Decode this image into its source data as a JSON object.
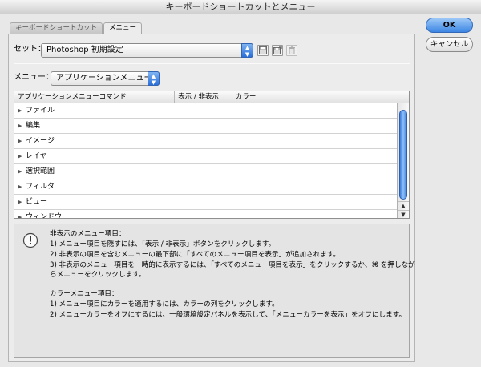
{
  "window": {
    "title": "キーボードショートカットとメニュー"
  },
  "tabs": [
    "キーボードショートカット",
    "メニュー"
  ],
  "set": {
    "label": "セット：",
    "value": "Photoshop 初期設定"
  },
  "menu": {
    "label": "メニュー：",
    "value": "アプリケーションメニュー"
  },
  "icons": {
    "save": "save-icon",
    "save_as": "save-as-icon",
    "delete": "trash-icon"
  },
  "table": {
    "columns": [
      "アプリケーションメニューコマンド",
      "表示 / 非表示",
      "カラー"
    ],
    "rows": [
      "ファイル",
      "編集",
      "イメージ",
      "レイヤー",
      "選択範囲",
      "フィルタ",
      "ビュー",
      "ウィンドウ"
    ]
  },
  "info": {
    "hidden_title": "非表示のメニュー項目：",
    "hidden_1": "1) メニュー項目を隠すには、「表示 / 非表示」ボタンをクリックします。",
    "hidden_2": "2) 非表示の項目を含むメニューの最下部に「すべてのメニュー項目を表示」が追加されます。",
    "hidden_3a": "3) 非表示のメニュー項目を一時的に表示するには、「すべてのメニュー項目を表示」をクリックするか、⌘ を押しなが",
    "hidden_3b": "らメニューをクリックします。",
    "color_title": "カラーメニュー項目：",
    "color_1": "1) メニュー項目にカラーを適用するには、カラーの列をクリックします。",
    "color_2": "2) メニューカラーをオフにするには、一般環境設定パネルを表示して、「メニューカラーを表示」をオフにします。"
  },
  "buttons": {
    "ok": "OK",
    "cancel": "キャンセル"
  }
}
